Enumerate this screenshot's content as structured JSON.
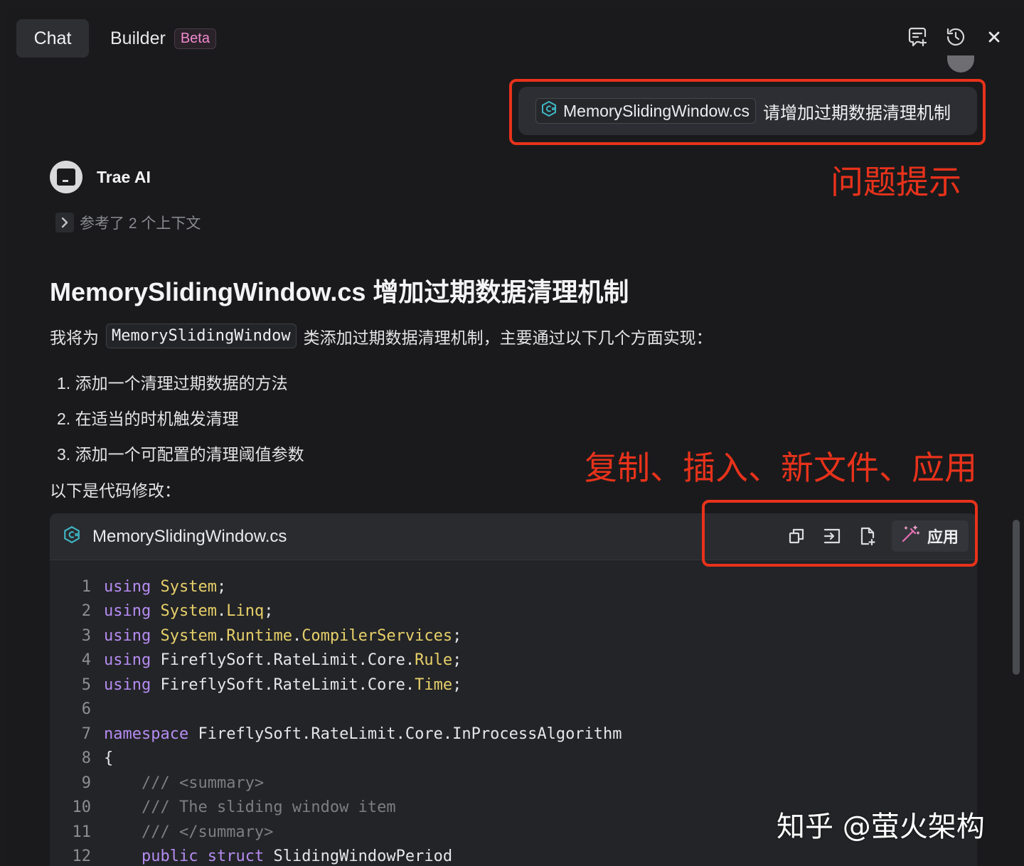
{
  "header": {
    "tab_chat": "Chat",
    "tab_builder": "Builder",
    "beta_badge": "Beta",
    "icons": [
      "new-chat-icon",
      "history-icon",
      "close-icon"
    ]
  },
  "user_message": {
    "file_chip": "MemorySlidingWindow.cs",
    "text": "请增加过期数据清理机制"
  },
  "annotations": {
    "question_hint": "问题提示",
    "actions_hint": "复制、插入、新文件、应用"
  },
  "ai": {
    "name": "Trae AI",
    "context_ref": "参考了 2 个上下文",
    "title": "MemorySlidingWindow.cs 增加过期数据清理机制",
    "intro_before": "我将为",
    "intro_code": "MemorySlidingWindow",
    "intro_after": "类添加过期数据清理机制，主要通过以下几个方面实现：",
    "list": [
      "1. 添加一个清理过期数据的方法",
      "2. 在适当的时机触发清理",
      "3. 添加一个可配置的清理阈值参数"
    ],
    "para2": "以下是代码修改："
  },
  "code_block": {
    "filename": "MemorySlidingWindow.cs",
    "apply_label": "应用",
    "lines": [
      {
        "n": "1"
      },
      {
        "n": "2"
      },
      {
        "n": "3"
      },
      {
        "n": "4"
      },
      {
        "n": "5"
      },
      {
        "n": "6"
      },
      {
        "n": "7"
      },
      {
        "n": "8"
      },
      {
        "n": "9"
      },
      {
        "n": "10"
      },
      {
        "n": "11"
      },
      {
        "n": "12"
      }
    ],
    "tokens": {
      "using": "using",
      "namespace": "namespace",
      "public": "public",
      "struct": "struct",
      "System": "System",
      "Linq": "Linq",
      "Runtime": "Runtime",
      "CompilerServices": "CompilerServices",
      "FireflySoft": "FireflySoft",
      "RateLimit": "RateLimit",
      "Core": "Core",
      "Rule": "Rule",
      "Time": "Time",
      "InProcessAlgorithm": "InProcessAlgorithm",
      "open_brace": "{",
      "c_summary_open": "/// <summary>",
      "c_desc": "/// The sliding window item",
      "c_summary_close": "/// </summary>",
      "SlidingWindowPeriod": "SlidingWindowPeriod"
    }
  },
  "watermark": "知乎 @萤火架构",
  "colors": {
    "background": "#1a1a1c",
    "annotation_red": "#e8321b",
    "keyword": "#b58cf2",
    "type": "#e7d06a",
    "comment": "#7d7e83",
    "beta": "#f08ad0"
  }
}
